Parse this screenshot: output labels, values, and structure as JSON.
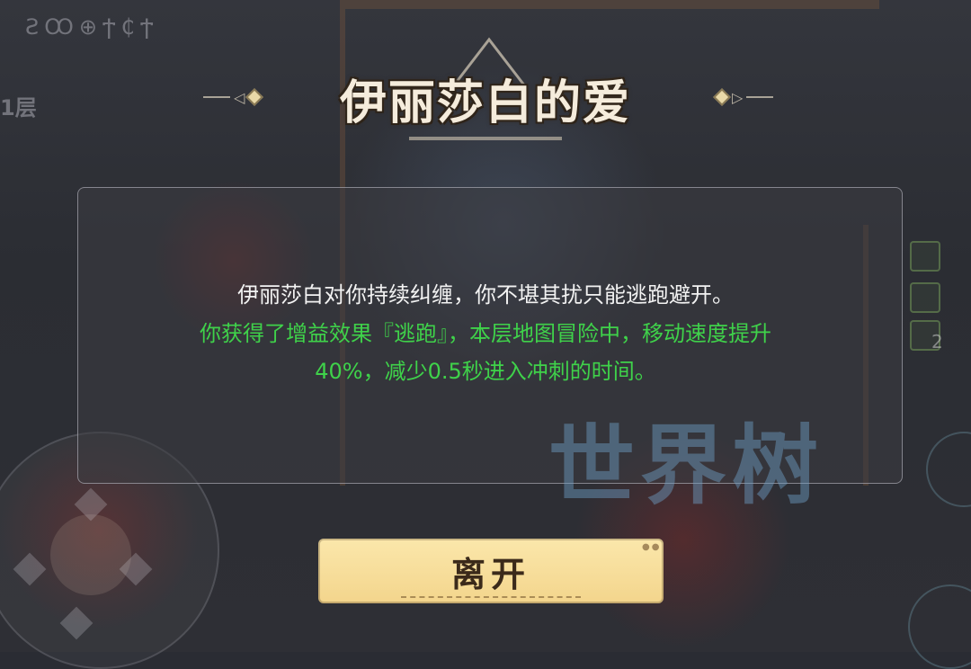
{
  "hud": {
    "glyphs": "ƧꝎ⊕Ϯ₵Ϯ",
    "floor_label": "1层"
  },
  "event": {
    "title": "伊丽莎白的爱",
    "description": "伊丽莎白对你持续纠缠，你不堪其扰只能逃跑避开。",
    "effect_line1": "你获得了增益效果『逃跑』，本层地图冒险中，移动速度提升",
    "effect_line2": "40%，减少0.5秒进入冲刺的时间。"
  },
  "buttons": {
    "leave_label": "离开"
  },
  "side_panel": {
    "count": "2"
  },
  "watermark": "世界树",
  "colors": {
    "description": "#f2f2f2",
    "effect": "#3fd24a",
    "button_bg": "#f3d58c",
    "button_text": "#3b2a1a"
  }
}
